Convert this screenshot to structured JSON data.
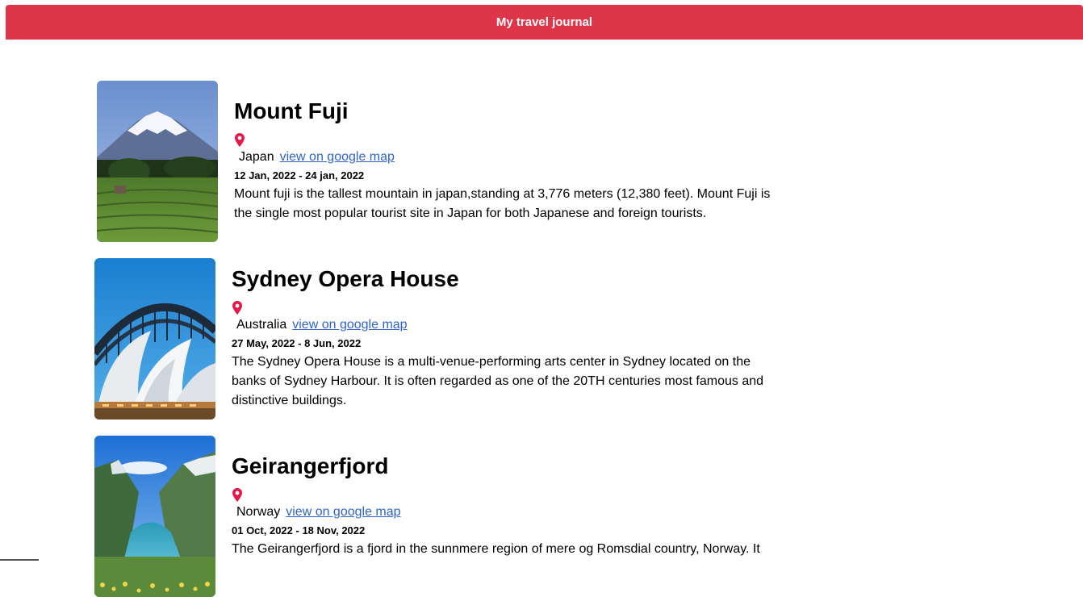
{
  "header": {
    "title": "My travel journal",
    "color": "#df3548"
  },
  "entries": [
    {
      "title": "Mount Fuji",
      "location": "Japan",
      "map_link": "view on google map",
      "dates": "12 Jan, 2022 - 24 jan, 2022",
      "description": "Mount fuji is the tallest mountain in japan,standing at 3,776 meters (12,380 feet). Mount Fuji is the single most popular tourist site in Japan for both Japanese and foreign tourists."
    },
    {
      "title": "Sydney Opera House",
      "location": "Australia",
      "map_link": "view on google map",
      "dates": "27 May, 2022 - 8 Jun, 2022",
      "description": "The Sydney Opera House is a multi-venue-performing arts center in Sydney located on the banks of Sydney Harbour. It is often regarded as one of the 20TH centuries most famous and distinctive buildings."
    },
    {
      "title": "Geirangerfjord",
      "location": "Norway",
      "map_link": "view on google map",
      "dates": "01 Oct, 2022 - 18 Nov, 2022",
      "description": "The Geirangerfjord is a fjord in the sunnmere region of mere og Romsdial country, Norway. It"
    }
  ],
  "icons": {
    "location": "location-pin-icon",
    "pin_color": "#e8174a"
  }
}
